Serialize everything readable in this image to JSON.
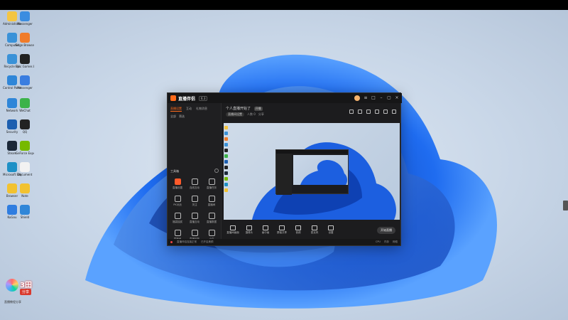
{
  "desktop": {
    "icons": [
      {
        "name": "Administrator",
        "color": "#f4c542"
      },
      {
        "name": "Messenger",
        "color": "#3b8de0"
      },
      {
        "name": "Computer",
        "color": "#3a92d8"
      },
      {
        "name": "Edge Browser",
        "color": "#f07c2b"
      },
      {
        "name": "Recycle Bin",
        "color": "#3a92d8"
      },
      {
        "name": "Epic Games Launcher",
        "color": "#222222"
      },
      {
        "name": "Control Panel",
        "color": "#2f86d8"
      },
      {
        "name": "Messenger",
        "color": "#3a7de0"
      },
      {
        "name": "Network",
        "color": "#2f86d8"
      },
      {
        "name": "WeChat",
        "color": "#3cb34a"
      },
      {
        "name": "Security",
        "color": "#1d5fb0"
      },
      {
        "name": "QQ",
        "color": "#222222"
      },
      {
        "name": "Steam",
        "color": "#1b2838"
      },
      {
        "name": "GeForce Experience",
        "color": "#76b900"
      },
      {
        "name": "Microsoft Edge",
        "color": "#1e90c6"
      },
      {
        "name": "Document",
        "color": "#f2f2f2"
      },
      {
        "name": "Browser",
        "color": "#f2c230"
      },
      {
        "name": "Note",
        "color": "#f2c230"
      },
      {
        "name": "KuGou",
        "color": "#2f7de0"
      },
      {
        "name": "Shield",
        "color": "#2f86d8"
      }
    ]
  },
  "app": {
    "name": "直播伴侣",
    "version": "6.3",
    "left_tabs": [
      "直播设置",
      "互动",
      "礼物消息"
    ],
    "filter": [
      "全部",
      "筛选"
    ],
    "tools_title": "工具箱",
    "tools": [
      "直播设置",
      "连线互动",
      "直播任务",
      "PK对战",
      "关注",
      "直播间",
      "福袋抽奖",
      "直播互动",
      "直播数据",
      "直播间",
      "直播回放",
      "小店"
    ],
    "room_title": "个人直播开始了",
    "room_badge": "开播",
    "room_sub": [
      "直播间设置",
      "人数 0",
      "分享"
    ],
    "controls": [
      "直播间画面",
      "摄像头",
      "画中画",
      "屏幕共享",
      "音频",
      "麦克风",
      "设置"
    ],
    "start_label": "开始直播",
    "status_left": "直播伴侣连接正常",
    "status_mid": "已开启美颜",
    "status_right": [
      "CPU",
      "内存",
      "网络"
    ]
  },
  "watermark": {
    "text": "3田",
    "badge": "分享",
    "sub": "直播教程分享"
  }
}
